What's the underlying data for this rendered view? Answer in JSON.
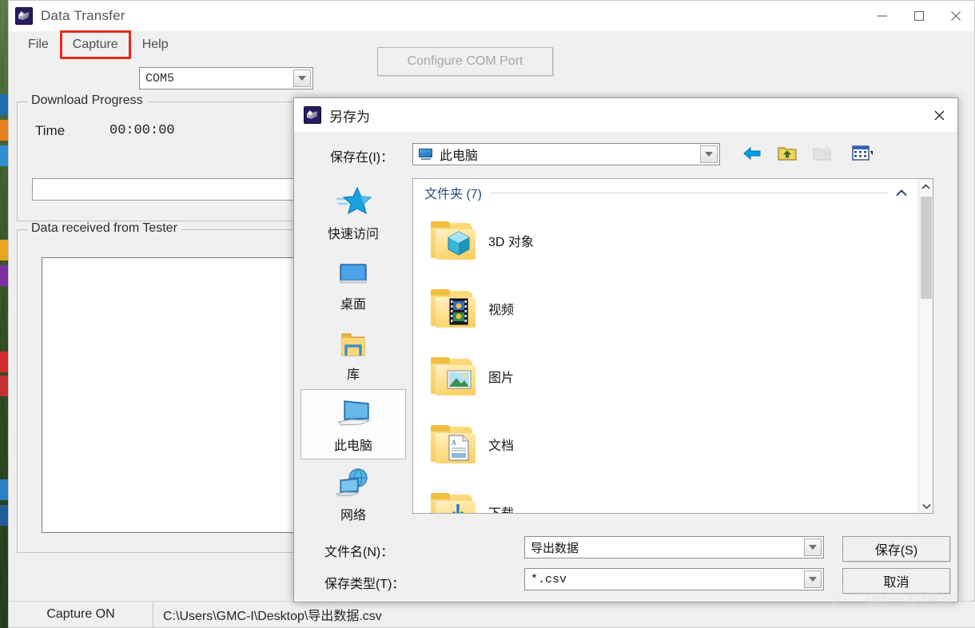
{
  "app": {
    "title": "Data Transfer",
    "icon": "app-icon",
    "window_buttons": [
      {
        "name": "minimize",
        "glyph": "—"
      },
      {
        "name": "maximize",
        "glyph": "□"
      },
      {
        "name": "close",
        "glyph": "✕"
      }
    ],
    "menu": [
      {
        "label": "File",
        "highlighted": false
      },
      {
        "label": "Capture",
        "highlighted": true
      },
      {
        "label": "Help",
        "highlighted": false
      }
    ],
    "highlight_color": "#e8291b",
    "com_port": {
      "value": "COM5",
      "icon": "chevron-down-icon"
    },
    "configure_button": {
      "label": "Configure COM Port",
      "disabled": true
    },
    "download_progress": {
      "legend": "Download Progress",
      "time_label": "Time",
      "time_value": "00:00:00",
      "progress_percent": 0
    },
    "data_panel": {
      "legend": "Data received from Tester",
      "content": ""
    },
    "statusbar": {
      "capture": "Capture ON",
      "path": "C:\\Users\\GMC-I\\Desktop\\导出数据.csv"
    }
  },
  "dialog": {
    "title": "另存为",
    "icon": "app-icon",
    "close_glyph": "✕",
    "lookin": {
      "label": "保存在(I)：",
      "value": "此电脑",
      "icon": "computer-icon",
      "arrow": "chevron-down-icon"
    },
    "toolbar": [
      {
        "name": "back-icon",
        "enabled": true
      },
      {
        "name": "up-folder-icon",
        "enabled": true
      },
      {
        "name": "new-folder-icon",
        "enabled": false
      },
      {
        "name": "views-icon",
        "enabled": true
      }
    ],
    "places": [
      {
        "label": "快速访问",
        "icon": "star-icon",
        "selected": false
      },
      {
        "label": "桌面",
        "icon": "desktop-icon",
        "selected": false
      },
      {
        "label": "库",
        "icon": "library-folder-icon",
        "selected": false
      },
      {
        "label": "此电脑",
        "icon": "computer-icon",
        "selected": true
      },
      {
        "label": "网络",
        "icon": "network-icon",
        "selected": false
      }
    ],
    "file_list": {
      "group_label": "文件夹 (7)",
      "group_collapse_glyph": "⌃",
      "items": [
        {
          "name": "3D 对象",
          "icon": "folder-3d-object-icon"
        },
        {
          "name": "视频",
          "icon": "folder-videos-icon"
        },
        {
          "name": "图片",
          "icon": "folder-pictures-icon"
        },
        {
          "name": "文档",
          "icon": "folder-documents-icon"
        },
        {
          "name": "下载",
          "icon": "folder-downloads-icon"
        }
      ],
      "scroll_up_glyph": "⌃",
      "scroll_down_glyph": "⌄"
    },
    "form": {
      "filename_label": "文件名(N)：",
      "filename_value": "导出数据",
      "filetype_label": "保存类型(T)：",
      "filetype_value": "*.csv",
      "save_button": "保存(S)",
      "cancel_button": "取消"
    }
  },
  "watermark": {
    "text": "电子发烧友",
    "url": "www.elecfans.com"
  }
}
